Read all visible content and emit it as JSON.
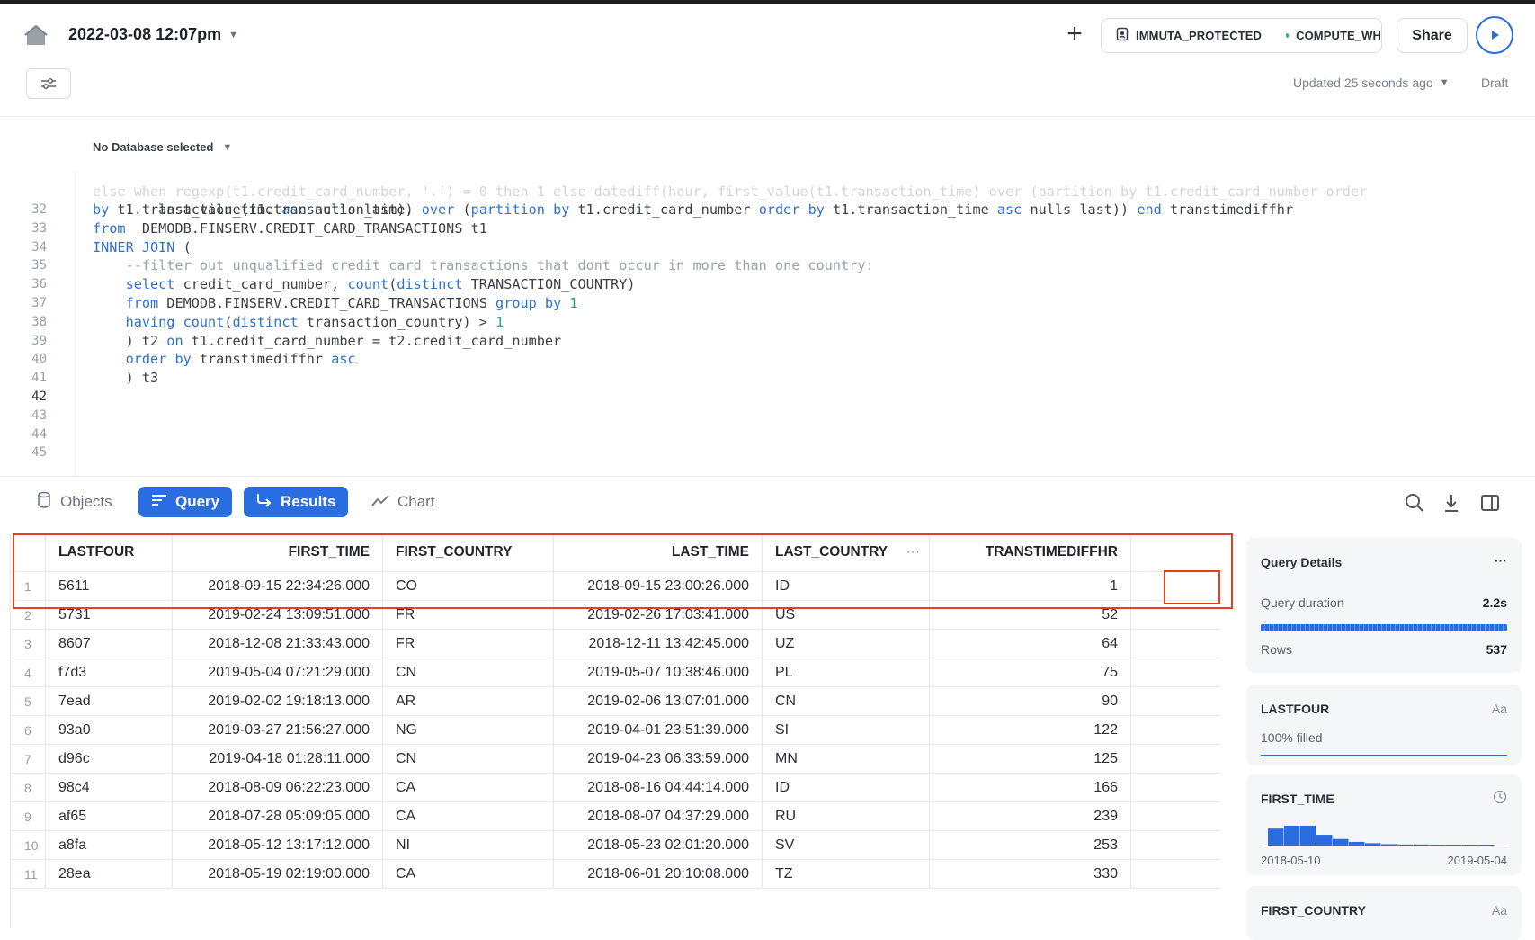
{
  "header": {
    "worksheet_title": "2022-03-08 12:07pm",
    "role": "IMMUTA_PROTECTED",
    "warehouse": "COMPUTE_WH",
    "share_label": "Share",
    "updated_text": "Updated 25 seconds ago",
    "draft_label": "Draft"
  },
  "editor": {
    "database_label": "No Database selected",
    "lines": [
      {
        "num": "32",
        "text": "        last_value(t1.transaction_time) over (partition by t1.credit_card_number order by t1.transaction_time asc nulls last)) end transtimediffhr"
      },
      {
        "num": "33",
        "text": "from  DEMODB.FINSERV.CREDIT_CARD_TRANSACTIONS t1"
      },
      {
        "num": "34",
        "text": "INNER JOIN ("
      },
      {
        "num": "35",
        "text": "    --filter out unqualified credit card transactions that dont occur in more than one country:"
      },
      {
        "num": "36",
        "text": "    select credit_card_number, count(distinct TRANSACTION_COUNTRY)"
      },
      {
        "num": "37",
        "text": "    from DEMODB.FINSERV.CREDIT_CARD_TRANSACTIONS group by 1"
      },
      {
        "num": "38",
        "text": "    having count(distinct transaction_country) > 1"
      },
      {
        "num": "39",
        "text": "    ) t2 on t1.credit_card_number = t2.credit_card_number"
      },
      {
        "num": "40",
        "text": "    order by transtimediffhr asc"
      },
      {
        "num": "41",
        "text": "    ) t3"
      },
      {
        "num": "42",
        "text": ""
      },
      {
        "num": "43",
        "text": ""
      },
      {
        "num": "44",
        "text": ""
      },
      {
        "num": "45",
        "text": ""
      }
    ],
    "wrapped_line_text": "by t1.transaction_time asc nulls last),"
  },
  "results_toolbar": {
    "tabs": [
      "Objects",
      "Query",
      "Results",
      "Chart"
    ]
  },
  "table": {
    "columns": [
      "LASTFOUR",
      "FIRST_TIME",
      "FIRST_COUNTRY",
      "LAST_TIME",
      "LAST_COUNTRY",
      "TRANSTIMEDIFFHR"
    ],
    "column_menu_glyph": "···",
    "rows": [
      [
        "1",
        "5611",
        "2018-09-15 22:34:26.000",
        "CO",
        "2018-09-15 23:00:26.000",
        "ID",
        "1"
      ],
      [
        "2",
        "5731",
        "2019-02-24 13:09:51.000",
        "FR",
        "2019-02-26 17:03:41.000",
        "US",
        "52"
      ],
      [
        "3",
        "8607",
        "2018-12-08 21:33:43.000",
        "FR",
        "2018-12-11 13:42:45.000",
        "UZ",
        "64"
      ],
      [
        "4",
        "f7d3",
        "2019-05-04 07:21:29.000",
        "CN",
        "2019-05-07 10:38:46.000",
        "PL",
        "75"
      ],
      [
        "5",
        "7ead",
        "2019-02-02 19:18:13.000",
        "AR",
        "2019-02-06 13:07:01.000",
        "CN",
        "90"
      ],
      [
        "6",
        "93a0",
        "2019-03-27 21:56:27.000",
        "NG",
        "2019-04-01 23:51:39.000",
        "SI",
        "122"
      ],
      [
        "7",
        "d96c",
        "2019-04-18 01:28:11.000",
        "CN",
        "2019-04-23 06:33:59.000",
        "MN",
        "125"
      ],
      [
        "8",
        "98c4",
        "2018-08-09 06:22:23.000",
        "CA",
        "2018-08-16 04:44:14.000",
        "ID",
        "166"
      ],
      [
        "9",
        "af65",
        "2018-07-28 05:09:05.000",
        "CA",
        "2018-08-07 04:37:29.000",
        "RU",
        "239"
      ],
      [
        "10",
        "a8fa",
        "2018-05-12 13:17:12.000",
        "NI",
        "2018-05-23 02:01:20.000",
        "SV",
        "253"
      ],
      [
        "11",
        "28ea",
        "2018-05-19 02:19:00.000",
        "CA",
        "2018-06-01 20:10:08.000",
        "TZ",
        "330"
      ]
    ]
  },
  "query_details": {
    "title": "Query Details",
    "menu_glyph": "···",
    "duration_label": "Query duration",
    "duration_value": "2.2s",
    "duration_fraction": 1.0,
    "rows_label": "Rows",
    "rows_value": "537"
  },
  "column_cards": {
    "lastfour": {
      "title": "LASTFOUR",
      "type_glyph": "Aa",
      "filled_text": "100% filled",
      "filled_fraction": 1.0
    },
    "first_time": {
      "title": "FIRST_TIME",
      "range_start": "2018-05-10",
      "range_end": "2019-05-04",
      "histogram": [
        0.55,
        0.64,
        0.64,
        0.36,
        0.23,
        0.14,
        0.1,
        0.07,
        0.06,
        0.06,
        0.05,
        0.05,
        0.05,
        0.05
      ]
    },
    "first_country": {
      "title": "FIRST_COUNTRY",
      "type_glyph": "Aa"
    }
  },
  "colors": {
    "accent": "#2a6de0",
    "highlight": "#e2431e",
    "keyword": "#2f73cf",
    "comment": "#9ca3ab"
  },
  "icons": [
    "home-icon",
    "plus-icon",
    "role-badge-icon",
    "run-icon",
    "filter-settings-icon",
    "database-icon",
    "query-lines-icon",
    "results-arrow-icon",
    "chart-line-icon",
    "search-icon",
    "download-icon",
    "split-panel-icon",
    "clock-icon"
  ]
}
